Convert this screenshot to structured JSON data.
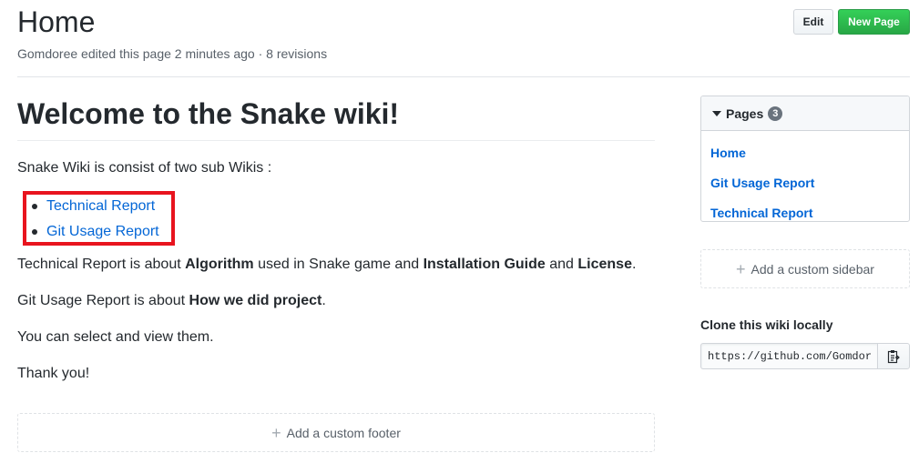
{
  "header": {
    "title": "Home",
    "meta": "Gomdoree edited this page 2 minutes ago · 8 revisions",
    "edit_label": "Edit",
    "new_page_label": "New Page"
  },
  "content": {
    "heading": "Welcome to the Snake wiki!",
    "intro": "Snake Wiki is consist of two sub Wikis :",
    "links": [
      "Technical Report",
      "Git Usage Report"
    ],
    "para1": {
      "t1": "Technical Report is about ",
      "b1": "Algorithm",
      "t2": " used in Snake game and ",
      "b2": "Installation Guide",
      "t3": " and ",
      "b3": "License",
      "t4": "."
    },
    "para2": {
      "t1": "Git Usage Report is about ",
      "b1": "How we did project",
      "t2": "."
    },
    "para3": "You can select and view them.",
    "para4": "Thank you!",
    "footer_label": "Add a custom footer"
  },
  "sidebar": {
    "pages_label": "Pages",
    "pages_count": "3",
    "pages": [
      "Home",
      "Git Usage Report",
      "Technical Report"
    ],
    "custom_sidebar_label": "Add a custom sidebar",
    "clone_title": "Clone this wiki locally",
    "clone_url": "https://github.com/Gomdoree/Snake.wiki.git"
  },
  "icons": {
    "caret": "caret-down-icon",
    "plus": "plus-icon",
    "clipboard": "clipboard-icon"
  },
  "colors": {
    "link": "#0366d6",
    "highlight_box": "#e8141e",
    "new_page_button": "#28a745"
  }
}
